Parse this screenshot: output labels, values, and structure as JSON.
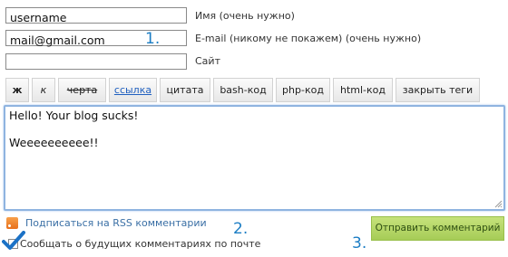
{
  "form": {
    "username": {
      "value": "username",
      "label": "Имя (очень нужно)"
    },
    "email": {
      "value": "mail@gmail.com",
      "label": "E-mail (никому не покажем) (очень нужно)"
    },
    "site": {
      "value": "",
      "label": "Сайт"
    }
  },
  "steps": {
    "one": "1.",
    "two": "2.",
    "three": "3."
  },
  "toolbar": {
    "bold": "ж",
    "italic": "к",
    "strike": "черта",
    "link": "ссылка",
    "quote": "цитата",
    "bash": "bash-код",
    "php": "php-код",
    "html": "html-код",
    "close_tags": "закрыть теги"
  },
  "comment": {
    "text": "Hello! Your blog sucks!\n\nWeeeeeeeeee!!"
  },
  "rss": {
    "label": "Подписаться на RSS комментарии",
    "icon": "rss-icon",
    "color": "#f28b2c"
  },
  "notify": {
    "label": "Сообщать о будущих комментариях по почте",
    "checked": true
  },
  "submit": {
    "label": "Отправить комментарий",
    "color": "#a9cf5a"
  },
  "colors": {
    "step_blue": "#1b7dc4",
    "editor_border": "#8fb4e0",
    "link": "#3a6fa5"
  }
}
